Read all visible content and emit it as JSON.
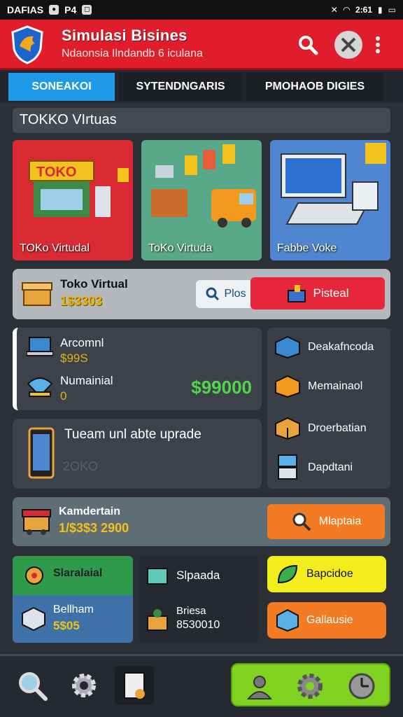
{
  "status_bar": {
    "left_text": "DAFIAS",
    "left_mid": "P4",
    "right_text": "2:61"
  },
  "header": {
    "title": "Simulasi Bisines",
    "subtitle": "Ndaonsia Ilndandb 6 iculana",
    "search_icon": "search-icon",
    "tools_icon": "tools-icon",
    "menu_icon": "more-vertical-icon"
  },
  "tabs": [
    {
      "label": "SONEAKOI",
      "active": true
    },
    {
      "label": "SYTENDNGARIS",
      "active": false
    },
    {
      "label": "PMOHAOB DIGIES",
      "active": false
    }
  ],
  "section": {
    "title": "TOKKO VIrtuas"
  },
  "cards": [
    {
      "label": "TOKo Virtudal",
      "color": "#d92a33"
    },
    {
      "label": "ToKo Virtuda",
      "color": "#5aa88a"
    },
    {
      "label": "Fabbe Voke",
      "color": "#4f86cf"
    }
  ],
  "store_row": {
    "name": "Toko Virtual",
    "value": "1$3303",
    "plus_label": "Plos",
    "pisteal_label": "Pisteal"
  },
  "stats": {
    "row1_label": "Arcomnl",
    "row1_value": "$99S",
    "row2_label": "Numainial",
    "row2_value": "0",
    "big_money": "$99000"
  },
  "upgrade": {
    "text": "Tueam unl abte uprade",
    "sub": "2OKO"
  },
  "right_list": [
    {
      "label": "Deakafncoda"
    },
    {
      "label": "Memainaol"
    },
    {
      "label": "Droerbatian"
    },
    {
      "label": "Dapdtani"
    }
  ],
  "wide_row": {
    "title": "Kamdertain",
    "value": "1/$3$3 2900",
    "button_label": "Mlaptaia"
  },
  "grid": {
    "green_label": "Slaralaial",
    "blue_title": "Bellham",
    "blue_value": "5$05",
    "dark_title": "Slpaada",
    "dark_sub_title": "Briesa",
    "dark_sub_value": "8530010",
    "yellow_label": "Bapcidoe",
    "orange_label": "Gallausie"
  },
  "bottom_nav": {
    "items": [
      "search-icon",
      "gear-icon",
      "tools-card-icon"
    ],
    "green_items": [
      "user-icon",
      "gear-icon",
      "clock-icon"
    ]
  }
}
